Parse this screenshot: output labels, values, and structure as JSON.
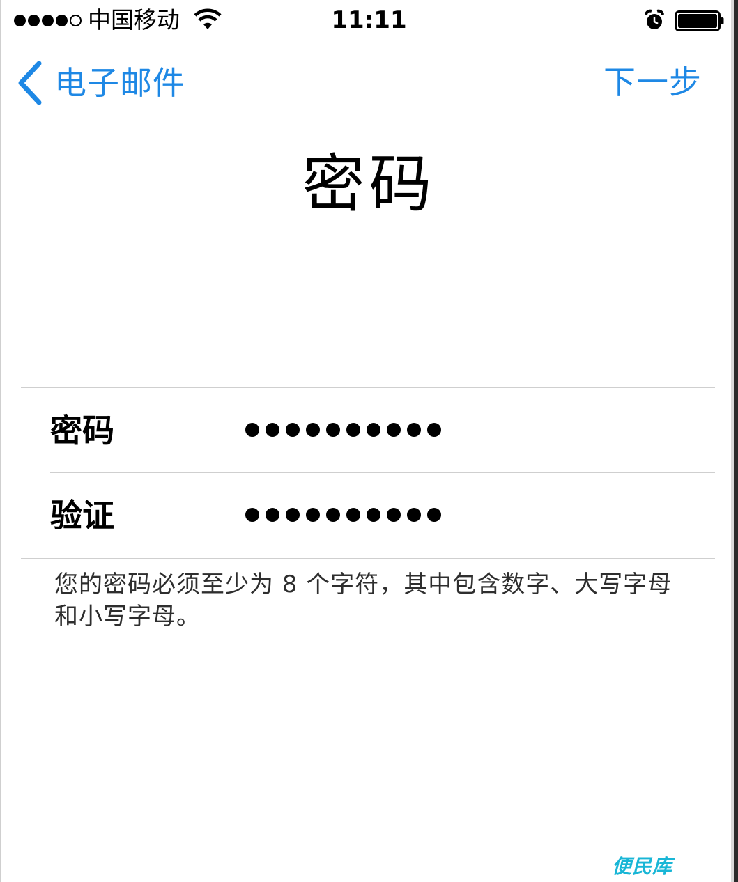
{
  "status_bar": {
    "carrier": "中国移动",
    "time": "11:11",
    "signal_strength": 4,
    "signal_max": 5,
    "wifi_icon": "wifi-icon",
    "alarm_icon": "alarm-icon",
    "battery_icon": "battery-icon"
  },
  "nav": {
    "back_label": "电子邮件",
    "back_icon": "chevron-left-icon",
    "next_label": "下一步",
    "accent_color": "#1e88e5"
  },
  "title": "密码",
  "form": {
    "password_label": "密码",
    "password_dots": 10,
    "verify_label": "验证",
    "verify_dots": 10
  },
  "hint": "您的密码必须至少为 8 个字符，其中包含数字、大写字母和小写字母。",
  "watermark": "便民库"
}
